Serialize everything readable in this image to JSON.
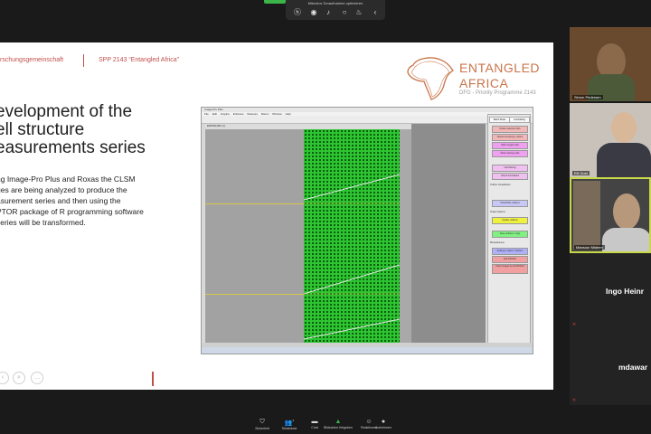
{
  "share_toolbar": {
    "title": "Mikrofon-Tonaufnahme optimieren",
    "tag_label": ""
  },
  "slide": {
    "header_left": "rschungsgemeinschaft",
    "header_spp": "SPP 2143 “Entangled Africa”",
    "logo": {
      "line1": "ENTANGLED",
      "line2": "AFRICA",
      "subtitle": "DFG - Priority Programme 2143"
    },
    "heading_lines": [
      "evelopment of the",
      "ell structure",
      "easurements series"
    ],
    "body_lines": [
      "ng Image-Pro Plus and Roxas the CLSM",
      "ges are being analyzed to produce the",
      "asurement series and then using the",
      "PTOR package of R programming software",
      "series will be transformed."
    ]
  },
  "embedded_app": {
    "title": "Image-Pro Plus",
    "menu": [
      "File",
      "Edit",
      "Acquire",
      "Enhance",
      "Measure",
      "Macro",
      "Window",
      "Help"
    ],
    "image_window_title": "ERW0011B (1)",
    "tabs": [
      "Batch Mode",
      "Cell Editing"
    ],
    "buttons_top": [
      {
        "label": "Delete selected cells",
        "color": "#f4b7b7"
      },
      {
        "label": "Delete lines/polyg. outline",
        "color": "#f4b7b7"
      },
      {
        "label": "Split merged cells",
        "color": "#f0a0f0"
      },
      {
        "label": "Draw missing cells",
        "color": "#f0a0f0"
      },
      {
        "label": "Cell filtering",
        "color": "#f0c0f0"
      },
      {
        "label": "Check boundaries",
        "color": "#f0c0f0"
      }
    ],
    "section_outline": "Outline Visualization",
    "button_show_outlines": {
      "label": "Show/Hide outlines",
      "color": "#c8c8f8"
    },
    "section_outputs": "Output Options",
    "button_update": {
      "label": "Update outlines",
      "color": "#f0f040"
    },
    "button_save": {
      "label": "Save outlines / rings",
      "color": "#80f080"
    },
    "section_misc": "Miscellaneous",
    "button_settings": {
      "label": "Settings / Adjust / Options",
      "color": "#b0b0f8"
    },
    "button_exit": {
      "label": "Exit ROXAS",
      "color": "#f0a0a0"
    },
    "button_close": {
      "label": "Close images & exit ROXAS",
      "color": "#f0a0a0"
    }
  },
  "participants": [
    {
      "name": "Simon Pedersen"
    },
    {
      "name": "Elli Gust"
    },
    {
      "name": "Mansour Mideen"
    },
    {
      "name": "Ingo Heinr"
    },
    {
      "name": "mdawar"
    }
  ],
  "zoom_bar": [
    {
      "label": "Sicherheit",
      "icon": "shield-icon"
    },
    {
      "label": "Teilnehmer",
      "icon": "participants-icon",
      "count": "2"
    },
    {
      "label": "Chat",
      "icon": "chat-icon"
    },
    {
      "label": "Bildschirm freigeben",
      "icon": "share-screen-icon"
    },
    {
      "label": "Reaktionen",
      "icon": "reactions-icon"
    },
    {
      "label": "Aufnehmen",
      "icon": "record-icon"
    }
  ],
  "colors": {
    "accent_red": "#c0504d",
    "logo_orange": "#c9754a",
    "share_green": "#3bb44a",
    "speaker_border": "#c7d84a",
    "cell_green": "#3df040"
  }
}
